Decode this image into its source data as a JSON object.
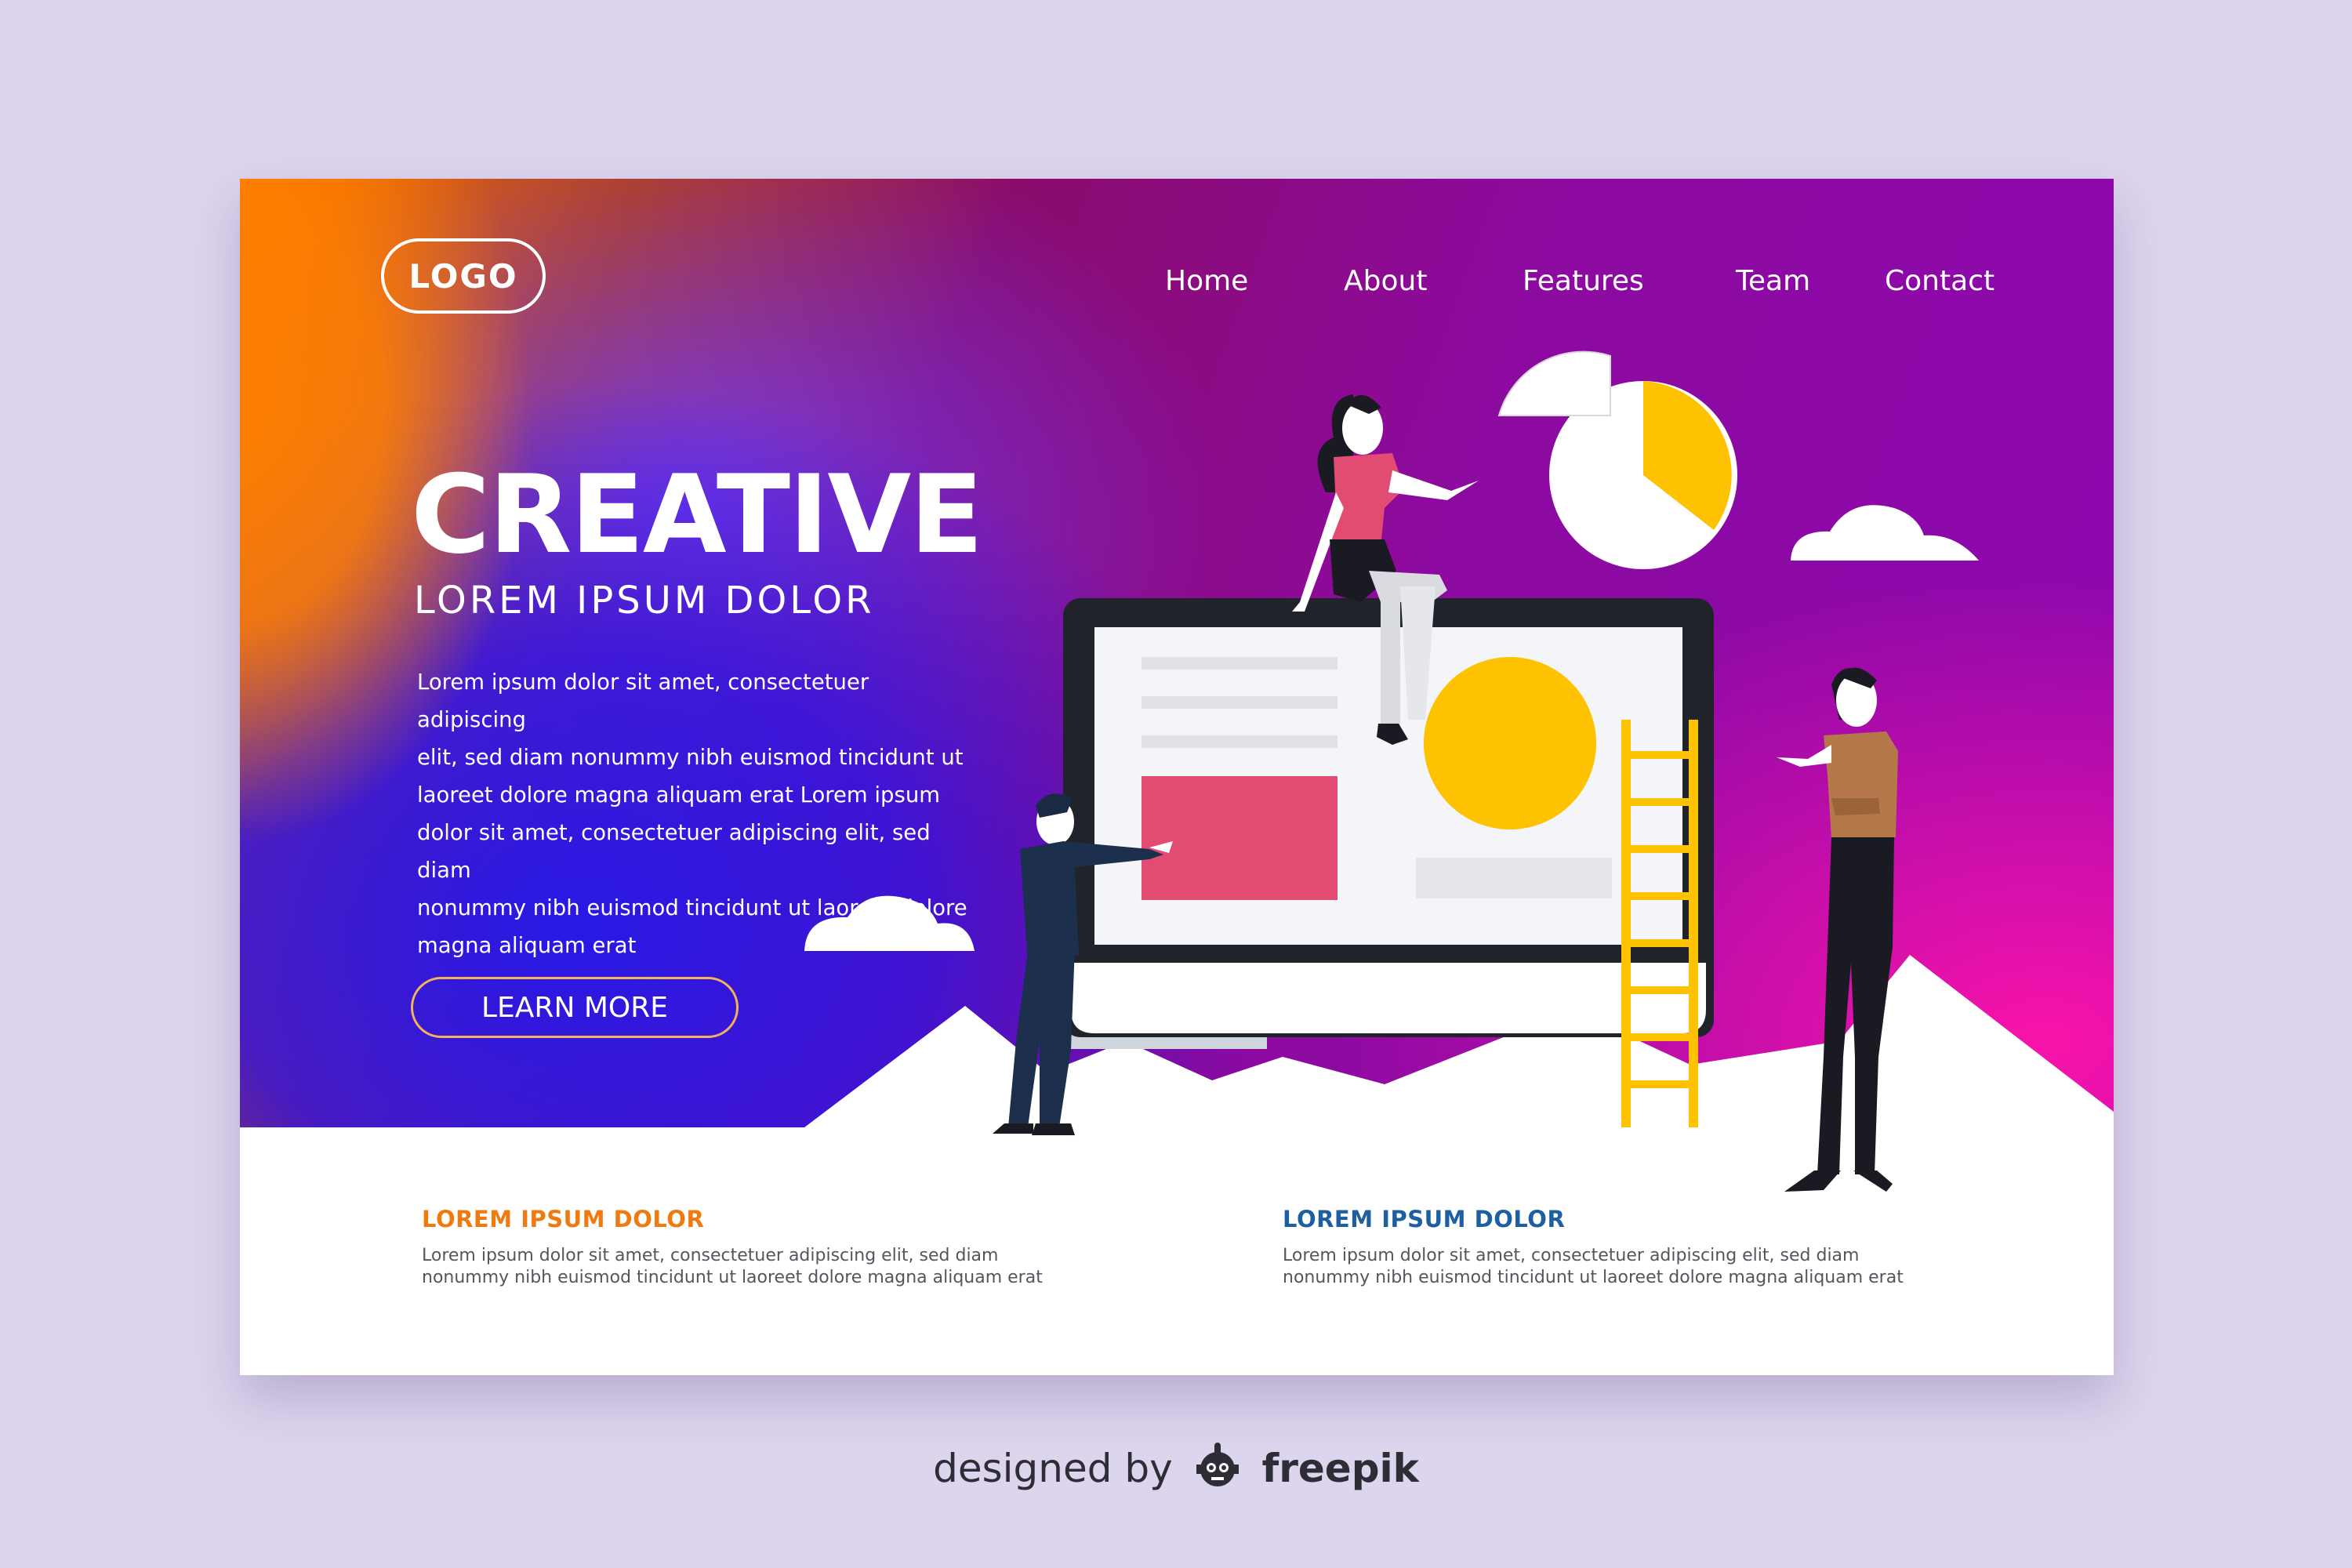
{
  "header": {
    "logo": "LOGO",
    "nav": [
      "Home",
      "About",
      "Features",
      "Team",
      "Contact"
    ]
  },
  "hero": {
    "title": "CREATIVE",
    "subtitle": "LOREM IPSUM DOLOR",
    "body_lines": [
      "Lorem ipsum dolor sit amet, consectetuer adipiscing",
      "elit, sed diam nonummy nibh euismod tincidunt ut",
      "laoreet dolore magna aliquam erat  Lorem ipsum",
      "dolor sit amet, consectetuer adipiscing elit, sed diam",
      "nonummy nibh euismod tincidunt ut laoreet dolore",
      "magna aliquam erat"
    ],
    "cta": "LEARN MORE"
  },
  "features": [
    {
      "title": "LOREM IPSUM DOLOR",
      "lines": [
        "Lorem ipsum dolor sit amet, consectetuer adipiscing elit, sed diam",
        "nonummy nibh euismod tincidunt ut laoreet dolore magna aliquam erat"
      ],
      "color": "#f07a10"
    },
    {
      "title": "LOREM IPSUM DOLOR",
      "lines": [
        "Lorem ipsum dolor sit amet, consectetuer adipiscing elit, sed diam",
        "nonummy nibh euismod tincidunt ut laoreet dolore magna aliquam erat"
      ],
      "color": "#1d5fa0"
    }
  ],
  "credit": {
    "prefix": "designed by",
    "brand": "freepik"
  },
  "colors": {
    "accent_orange": "#f07a10",
    "accent_blue": "#1d5fa0",
    "yellow": "#ffc200",
    "pink": "#e24b72",
    "button_border": "#f5b25a"
  }
}
